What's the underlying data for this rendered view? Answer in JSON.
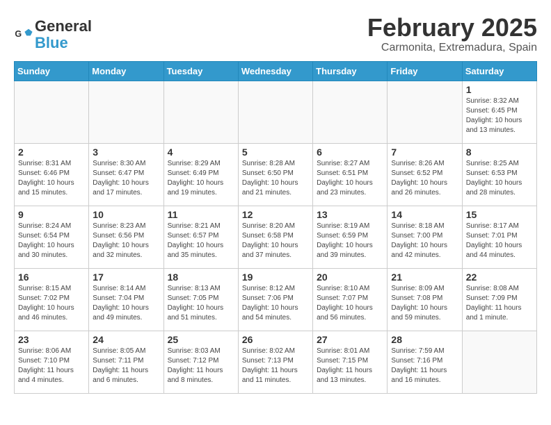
{
  "logo": {
    "text_general": "General",
    "text_blue": "Blue"
  },
  "title": "February 2025",
  "location": "Carmonita, Extremadura, Spain",
  "weekdays": [
    "Sunday",
    "Monday",
    "Tuesday",
    "Wednesday",
    "Thursday",
    "Friday",
    "Saturday"
  ],
  "weeks": [
    [
      {
        "day": "",
        "info": ""
      },
      {
        "day": "",
        "info": ""
      },
      {
        "day": "",
        "info": ""
      },
      {
        "day": "",
        "info": ""
      },
      {
        "day": "",
        "info": ""
      },
      {
        "day": "",
        "info": ""
      },
      {
        "day": "1",
        "info": "Sunrise: 8:32 AM\nSunset: 6:45 PM\nDaylight: 10 hours and 13 minutes."
      }
    ],
    [
      {
        "day": "2",
        "info": "Sunrise: 8:31 AM\nSunset: 6:46 PM\nDaylight: 10 hours and 15 minutes."
      },
      {
        "day": "3",
        "info": "Sunrise: 8:30 AM\nSunset: 6:47 PM\nDaylight: 10 hours and 17 minutes."
      },
      {
        "day": "4",
        "info": "Sunrise: 8:29 AM\nSunset: 6:49 PM\nDaylight: 10 hours and 19 minutes."
      },
      {
        "day": "5",
        "info": "Sunrise: 8:28 AM\nSunset: 6:50 PM\nDaylight: 10 hours and 21 minutes."
      },
      {
        "day": "6",
        "info": "Sunrise: 8:27 AM\nSunset: 6:51 PM\nDaylight: 10 hours and 23 minutes."
      },
      {
        "day": "7",
        "info": "Sunrise: 8:26 AM\nSunset: 6:52 PM\nDaylight: 10 hours and 26 minutes."
      },
      {
        "day": "8",
        "info": "Sunrise: 8:25 AM\nSunset: 6:53 PM\nDaylight: 10 hours and 28 minutes."
      }
    ],
    [
      {
        "day": "9",
        "info": "Sunrise: 8:24 AM\nSunset: 6:54 PM\nDaylight: 10 hours and 30 minutes."
      },
      {
        "day": "10",
        "info": "Sunrise: 8:23 AM\nSunset: 6:56 PM\nDaylight: 10 hours and 32 minutes."
      },
      {
        "day": "11",
        "info": "Sunrise: 8:21 AM\nSunset: 6:57 PM\nDaylight: 10 hours and 35 minutes."
      },
      {
        "day": "12",
        "info": "Sunrise: 8:20 AM\nSunset: 6:58 PM\nDaylight: 10 hours and 37 minutes."
      },
      {
        "day": "13",
        "info": "Sunrise: 8:19 AM\nSunset: 6:59 PM\nDaylight: 10 hours and 39 minutes."
      },
      {
        "day": "14",
        "info": "Sunrise: 8:18 AM\nSunset: 7:00 PM\nDaylight: 10 hours and 42 minutes."
      },
      {
        "day": "15",
        "info": "Sunrise: 8:17 AM\nSunset: 7:01 PM\nDaylight: 10 hours and 44 minutes."
      }
    ],
    [
      {
        "day": "16",
        "info": "Sunrise: 8:15 AM\nSunset: 7:02 PM\nDaylight: 10 hours and 46 minutes."
      },
      {
        "day": "17",
        "info": "Sunrise: 8:14 AM\nSunset: 7:04 PM\nDaylight: 10 hours and 49 minutes."
      },
      {
        "day": "18",
        "info": "Sunrise: 8:13 AM\nSunset: 7:05 PM\nDaylight: 10 hours and 51 minutes."
      },
      {
        "day": "19",
        "info": "Sunrise: 8:12 AM\nSunset: 7:06 PM\nDaylight: 10 hours and 54 minutes."
      },
      {
        "day": "20",
        "info": "Sunrise: 8:10 AM\nSunset: 7:07 PM\nDaylight: 10 hours and 56 minutes."
      },
      {
        "day": "21",
        "info": "Sunrise: 8:09 AM\nSunset: 7:08 PM\nDaylight: 10 hours and 59 minutes."
      },
      {
        "day": "22",
        "info": "Sunrise: 8:08 AM\nSunset: 7:09 PM\nDaylight: 11 hours and 1 minute."
      }
    ],
    [
      {
        "day": "23",
        "info": "Sunrise: 8:06 AM\nSunset: 7:10 PM\nDaylight: 11 hours and 4 minutes."
      },
      {
        "day": "24",
        "info": "Sunrise: 8:05 AM\nSunset: 7:11 PM\nDaylight: 11 hours and 6 minutes."
      },
      {
        "day": "25",
        "info": "Sunrise: 8:03 AM\nSunset: 7:12 PM\nDaylight: 11 hours and 8 minutes."
      },
      {
        "day": "26",
        "info": "Sunrise: 8:02 AM\nSunset: 7:13 PM\nDaylight: 11 hours and 11 minutes."
      },
      {
        "day": "27",
        "info": "Sunrise: 8:01 AM\nSunset: 7:15 PM\nDaylight: 11 hours and 13 minutes."
      },
      {
        "day": "28",
        "info": "Sunrise: 7:59 AM\nSunset: 7:16 PM\nDaylight: 11 hours and 16 minutes."
      },
      {
        "day": "",
        "info": ""
      }
    ]
  ]
}
